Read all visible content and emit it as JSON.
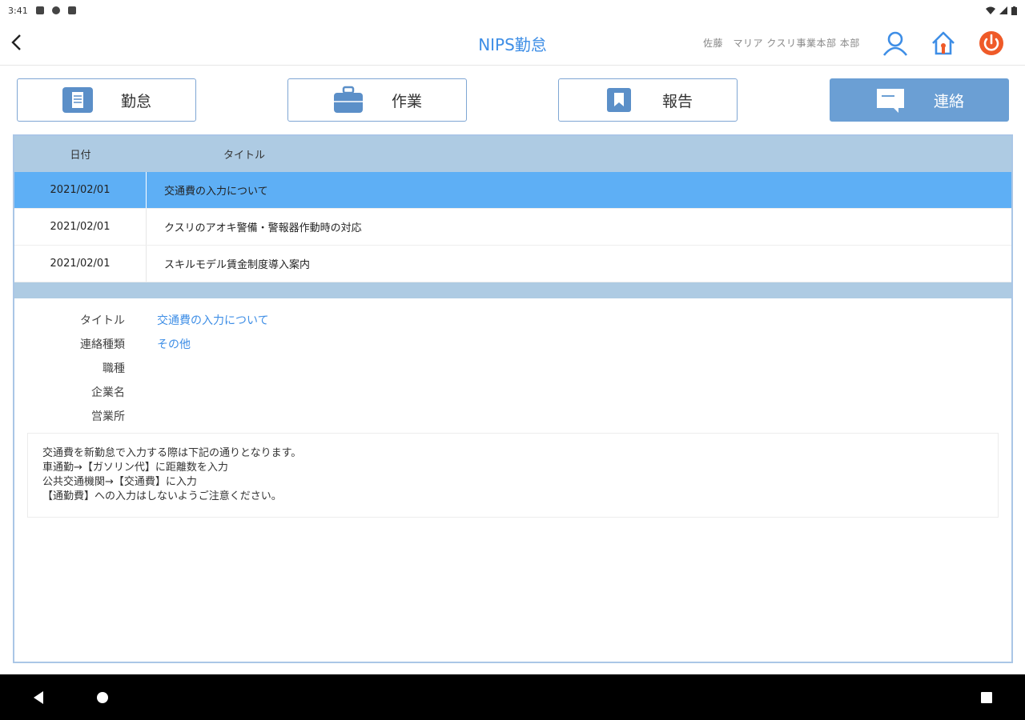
{
  "status_bar": {
    "time": "3:41",
    "icons_left": [
      "notification-icon",
      "sync-icon",
      "sd-card-icon"
    ],
    "icons_right": [
      "wifi-icon",
      "signal-icon",
      "battery-icon"
    ]
  },
  "app_bar": {
    "title": "NIPS勤怠",
    "user_name": "佐藤　マリア クスリ事業本部 本部",
    "icons": [
      "back-icon",
      "user-icon",
      "home-icon",
      "power-icon"
    ]
  },
  "tabs": [
    {
      "label": "勤怠",
      "icon": "document-icon",
      "active": false
    },
    {
      "label": "作業",
      "icon": "briefcase-icon",
      "active": false
    },
    {
      "label": "報告",
      "icon": "bookmark-icon",
      "active": false
    },
    {
      "label": "連絡",
      "icon": "message-icon",
      "active": true
    }
  ],
  "list": {
    "columns": [
      "日付",
      "タイトル"
    ],
    "rows": [
      {
        "date": "2021/02/01",
        "title": "交通費の入力について",
        "selected": true
      },
      {
        "date": "2021/02/01",
        "title": "クスリのアオキ警備・警報器作動時の対応",
        "selected": false
      },
      {
        "date": "2021/02/01",
        "title": "スキルモデル賃金制度導入案内",
        "selected": false
      }
    ]
  },
  "detail": {
    "fields": [
      {
        "label": "タイトル",
        "value": "交通費の入力について"
      },
      {
        "label": "連絡種類",
        "value": "その他"
      },
      {
        "label": "職種",
        "value": ""
      },
      {
        "label": "企業名",
        "value": ""
      },
      {
        "label": "営業所",
        "value": ""
      }
    ],
    "message_lines": [
      "交通費を新勤怠で入力する際は下記の通りとなります。",
      "車通勤→【ガソリン代】に距離数を入力",
      "公共交通機関→【交通費】に入力",
      "【通勤費】への入力はしないようご注意ください。"
    ]
  },
  "colors": {
    "accent": "#3e8ee6",
    "header_bg": "#aecbe3",
    "selected_row": "#5eaff5",
    "active_tab": "#6b9fd4",
    "power": "#ef5a28"
  },
  "nav_bar": {
    "icons": [
      "nav-back-icon",
      "nav-home-icon",
      "nav-recents-icon"
    ]
  }
}
